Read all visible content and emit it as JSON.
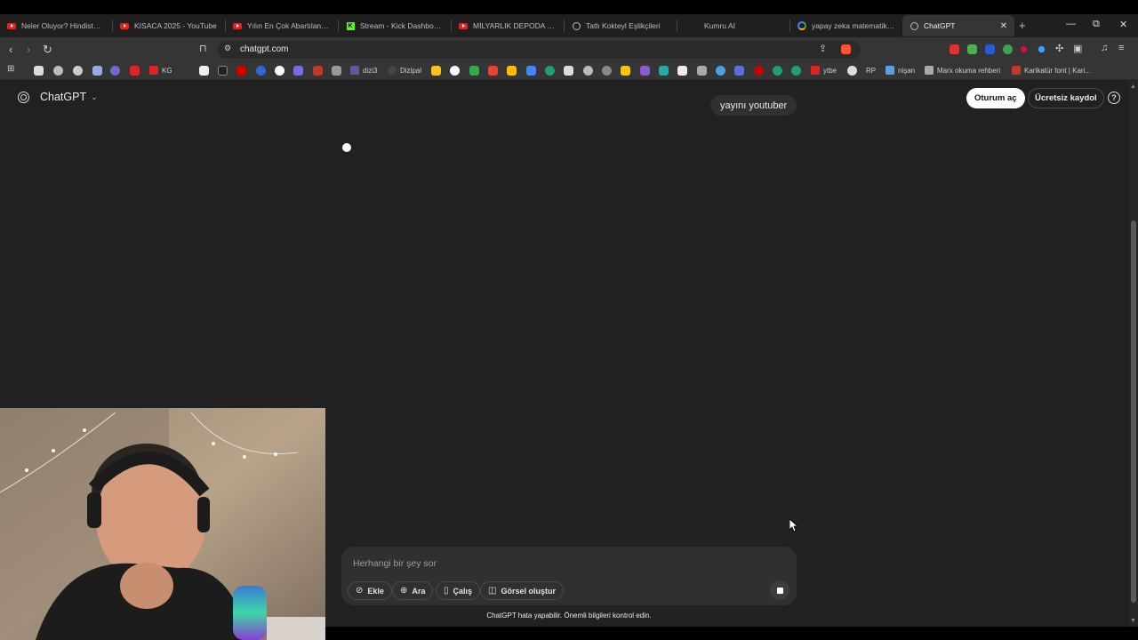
{
  "browser": {
    "tabs": [
      {
        "label": "Neler Oluyor? Hindistan B",
        "icon": "youtube-icon"
      },
      {
        "label": "KISACA 2025 - YouTube",
        "icon": "youtube-icon"
      },
      {
        "label": "Yılın En Çok Abartılan Film",
        "icon": "youtube-icon"
      },
      {
        "label": "Stream - Kick Dashboard",
        "icon": "kick-icon"
      },
      {
        "label": "MİLYARLIK DEPODA PC TO",
        "icon": "youtube-icon"
      },
      {
        "label": "Tatlı Kokteyl Eşlikçileri",
        "icon": "openai-icon"
      },
      {
        "label": "Kumru AI",
        "icon": "none"
      },
      {
        "label": "yapay zeka matematik sor",
        "icon": "google-icon"
      },
      {
        "label": "ChatGPT",
        "icon": "openai-icon",
        "active": true
      }
    ],
    "url": "chatgpt.com",
    "bookmarks": [
      {
        "label": "KG",
        "color": "#e02323"
      },
      {
        "label": "dizi3",
        "color": "#5a5aa0"
      },
      {
        "label": "Dizipal",
        "color": "#444444"
      },
      {
        "label": "ytbe",
        "color": "#e02323"
      },
      {
        "label": "RP",
        "color": "#6a6a6a"
      },
      {
        "label": "nişan",
        "color": "#5aa0e0"
      },
      {
        "label": "Marx okuma rehberi",
        "color": "#aaaaaa"
      },
      {
        "label": "Karikatür font | Kari...",
        "color": "#c0392b"
      }
    ]
  },
  "page": {
    "brand": "ChatGPT",
    "login_label": "Oturum aç",
    "signup_label": "Ücretsiz kaydol",
    "help_label": "?",
    "user_message": "yayını youtuber",
    "composer": {
      "placeholder": "Herhangi bir şey sor",
      "tools": [
        {
          "label": "Ekle",
          "icon": "paperclip-icon"
        },
        {
          "label": "Ara",
          "icon": "globe-icon"
        },
        {
          "label": "Çalış",
          "icon": "book-icon"
        },
        {
          "label": "Görsel oluştur",
          "icon": "image-icon"
        }
      ]
    },
    "disclaimer": "ChatGPT hata yapabilir. Önemli bilgileri kontrol edin."
  },
  "colors": {
    "page_bg": "#212121",
    "composer_bg": "#303030",
    "tab_active": "#353535",
    "login_bg": "#ffffff"
  }
}
